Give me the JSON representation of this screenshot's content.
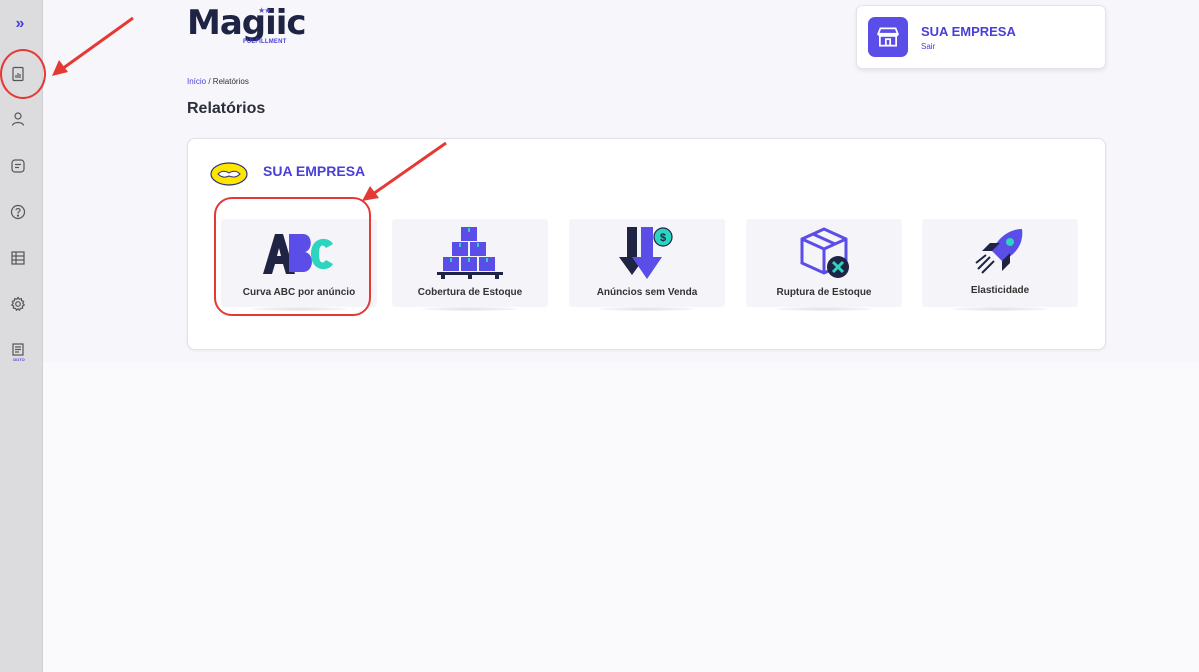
{
  "sidebar": {
    "expand_icon": "»",
    "doc_label": "DOTO",
    "items": [
      "reports-icon",
      "user-icon",
      "message-icon",
      "help-icon",
      "table-icon",
      "gear-icon",
      "document-icon"
    ]
  },
  "header": {
    "logo_text": "Magiic",
    "logo_sub": "FULFILLMENT",
    "logo_stars": "★★",
    "company_name": "SUA EMPRESA",
    "logout": "Sair"
  },
  "breadcrumb": {
    "home": "Início",
    "separator": " / ",
    "current": "Relatórios"
  },
  "page_title": "Relatórios",
  "panel": {
    "company": "SUA EMPRESA",
    "reports": [
      {
        "label": "Curva ABC por anúncio",
        "icon": "abc-icon"
      },
      {
        "label": "Cobertura de Estoque",
        "icon": "boxes-pallet-icon"
      },
      {
        "label": "Anúncios sem Venda",
        "icon": "down-arrow-dollar-icon"
      },
      {
        "label": "Ruptura de Estoque",
        "icon": "box-x-icon"
      },
      {
        "label": "Elasticidade",
        "icon": "rocket-icon"
      }
    ]
  },
  "colors": {
    "accent": "#4a3fd8",
    "annotation": "#e53935",
    "teal": "#2dd4bf",
    "dark": "#1f2344"
  }
}
